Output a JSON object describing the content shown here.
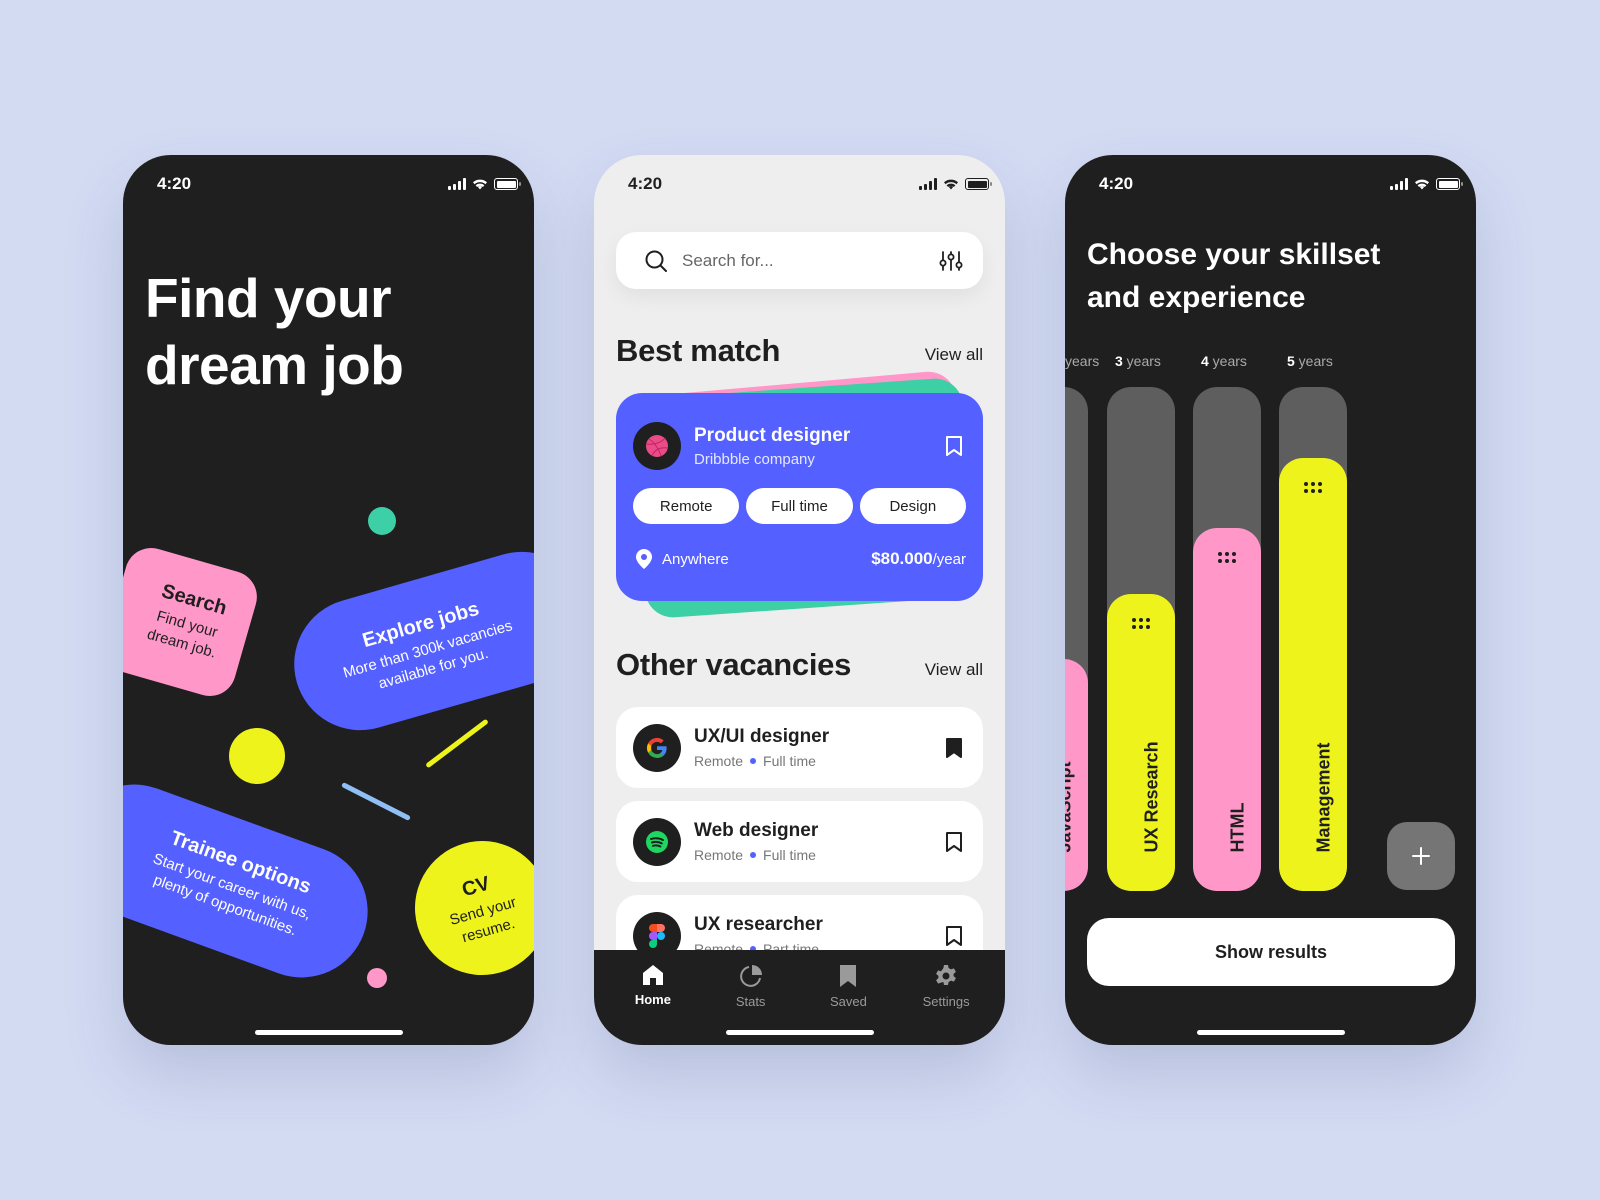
{
  "status_bar": {
    "time": "4:20"
  },
  "colors": {
    "background": "#d3dbf3",
    "dark": "#1f1f1f",
    "blue": "#5460ff",
    "pink": "#ff97c9",
    "yellow": "#eef41b",
    "green": "#3dcfa6",
    "light_blue": "#8fbff5",
    "gray_track": "#5e5e5e"
  },
  "onboarding": {
    "title_line1": "Find your",
    "title_line2": "dream job",
    "cards": [
      {
        "title": "Search",
        "line1": "Find your",
        "line2": "dream job."
      },
      {
        "title": "Explore jobs",
        "line1": "More than 300k vacancies",
        "line2": "available for you."
      },
      {
        "title": "Trainee options",
        "line1": "Start your career with us,",
        "line2": "plenty of opportunities."
      },
      {
        "title": "CV",
        "line1": "Send your",
        "line2": "resume."
      }
    ]
  },
  "home": {
    "search_placeholder": "Search for...",
    "best_match": {
      "heading": "Best match",
      "view_all": "View all",
      "job": {
        "title": "Product designer",
        "company": "Dribbble company",
        "tags": [
          "Remote",
          "Full time",
          "Design"
        ],
        "location": "Anywhere",
        "salary": "$80.000",
        "salary_period": "/year",
        "bookmarked": false
      }
    },
    "other_vacancies": {
      "heading": "Other vacancies",
      "view_all": "View all",
      "items": [
        {
          "title": "UX/UI designer",
          "location": "Remote",
          "type": "Full time",
          "logo": "google-logo",
          "bookmarked": true
        },
        {
          "title": "Web designer",
          "location": "Remote",
          "type": "Full time",
          "logo": "spotify-logo",
          "bookmarked": false
        },
        {
          "title": "UX researcher",
          "location": "Remote",
          "type": "Part time",
          "logo": "figma-logo",
          "bookmarked": false
        }
      ]
    },
    "tabs": [
      {
        "label": "Home",
        "icon": "home-icon",
        "active": true
      },
      {
        "label": "Stats",
        "icon": "pie-chart-icon",
        "active": false
      },
      {
        "label": "Saved",
        "icon": "bookmark-icon",
        "active": false
      },
      {
        "label": "Settings",
        "icon": "gear-icon",
        "active": false
      }
    ]
  },
  "skills": {
    "title_line1": "Choose your skillset",
    "title_line2": "and experience",
    "items": [
      {
        "name": "JavaScript",
        "years_num": "",
        "years_label": "years",
        "level": 0.46,
        "color": "#ff97c9"
      },
      {
        "name": "UX Research",
        "years_num": "3",
        "years_label": " years",
        "level": 0.59,
        "color": "#eef41b"
      },
      {
        "name": "HTML",
        "years_num": "4",
        "years_label": " years",
        "level": 0.72,
        "color": "#ff97c9"
      },
      {
        "name": "Management",
        "years_num": "5",
        "years_label": " years",
        "level": 0.86,
        "color": "#eef41b"
      }
    ],
    "add_label": "+",
    "show_results": "Show results"
  }
}
